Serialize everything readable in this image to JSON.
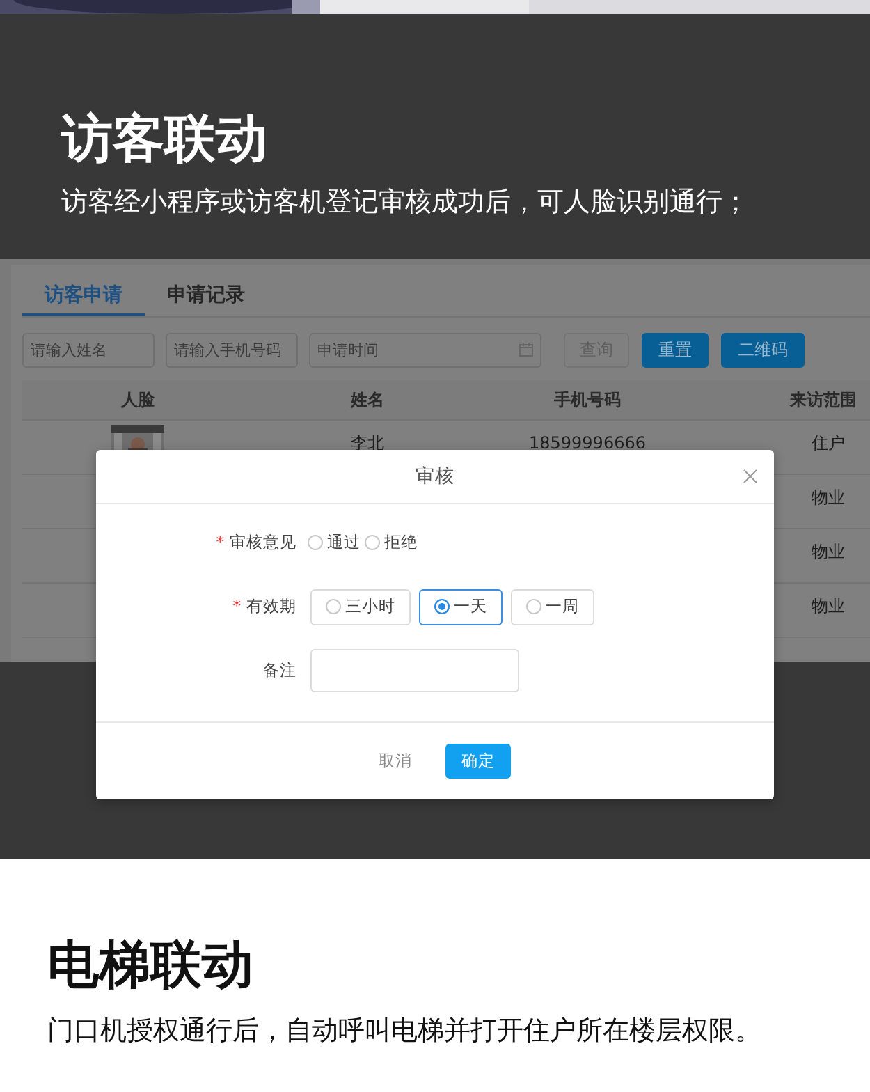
{
  "intro": {
    "title": "访客联动",
    "description": "访客经小程序或访客机登记审核成功后，可人脸识别通行；"
  },
  "app": {
    "tabs": [
      {
        "label": "访客申请",
        "selected": true
      },
      {
        "label": "申请记录",
        "selected": false
      }
    ],
    "filters": [
      {
        "kind": "text",
        "placeholder": "请输入姓名"
      },
      {
        "kind": "text",
        "placeholder": "请输入手机号码"
      },
      {
        "kind": "date",
        "placeholder": "申请时间"
      }
    ],
    "buttons": [
      {
        "kind": "plain",
        "label": "查询"
      },
      {
        "kind": "primary",
        "label": "重置"
      },
      {
        "kind": "primary",
        "label": "二维码"
      }
    ],
    "table": {
      "columns": [
        "人脸",
        "姓名",
        "手机号码",
        "来访范围"
      ],
      "rows": [
        {
          "name": "李北",
          "phone": "18599996666",
          "scope": "住户"
        },
        {
          "scope": "物业"
        },
        {
          "scope": "物业"
        },
        {
          "scope": "物业"
        }
      ]
    }
  },
  "dialog": {
    "title": "审核",
    "fields": [
      {
        "kind": "radio",
        "label": "审核意见",
        "required_mark": "*",
        "options": [
          {
            "label": "通过",
            "selected": false
          },
          {
            "label": "拒绝",
            "selected": false
          }
        ]
      },
      {
        "kind": "radio-button",
        "label": "有效期",
        "required_mark": "*",
        "options": [
          {
            "label": "三小时",
            "selected": false
          },
          {
            "label": "一天",
            "selected": true
          },
          {
            "label": "一周",
            "selected": false
          }
        ]
      },
      {
        "kind": "textarea",
        "label": "备注"
      }
    ],
    "buttons": [
      {
        "kind": "text",
        "label": "取消"
      },
      {
        "kind": "primary",
        "label": "确定"
      }
    ]
  },
  "elevator": {
    "title": "电梯联动",
    "description": "门口机授权通行后，自动呼叫电梯并打开住户所在楼层权限。"
  }
}
